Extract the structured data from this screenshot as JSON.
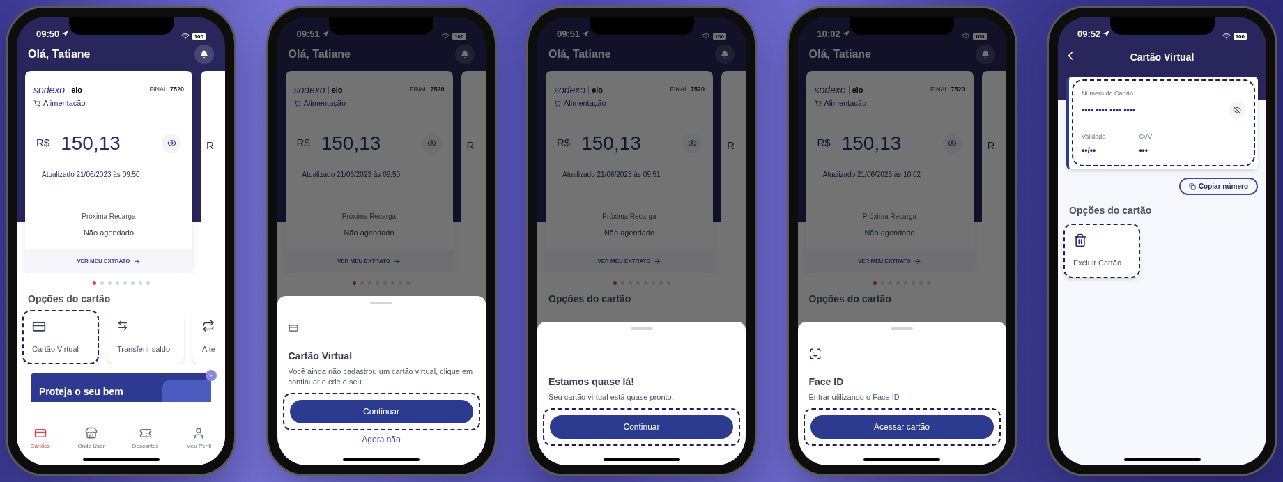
{
  "phones": [
    {
      "kind": "home",
      "time": "09:50",
      "battery": "100",
      "greeting": "Olá, Tatiane",
      "dimmed": false,
      "card": {
        "brand": "sodexo",
        "network": "elo",
        "final_label": "FINAL",
        "final_number": "7520",
        "category": "Alimentação",
        "currency": "R$",
        "amount": "150,13",
        "updated": "Atualizado 21/06/2023 às 09:50",
        "next_label": "Próxima Recarga",
        "next_value": "Não agendado",
        "statement_link": "VER MEU EXTRATO"
      },
      "peek_text": "R",
      "dots": [
        {
          "selected": true
        },
        {
          "selected": false
        },
        {
          "selected": false
        },
        {
          "selected": false
        },
        {
          "selected": false
        },
        {
          "selected": false
        },
        {
          "selected": false
        },
        {
          "selected": false
        }
      ],
      "options_title": "Opções do cartão",
      "options": [
        {
          "kind": "virtual-card",
          "label": "Cartão Virtual",
          "highlighted": true
        },
        {
          "kind": "transfer",
          "label": "Transferir saldo",
          "highlighted": false
        },
        {
          "kind": "swap",
          "label": "Alte",
          "highlighted": false
        }
      ],
      "banner": "Proteja o seu bem",
      "nav": [
        {
          "kind": "cards",
          "label": "Cartões",
          "selected": true
        },
        {
          "kind": "store",
          "label": "Onde Usar",
          "selected": false
        },
        {
          "kind": "ticket",
          "label": "Descontos",
          "selected": false
        },
        {
          "kind": "profile",
          "label": "Meu Perfil",
          "selected": false
        }
      ]
    },
    {
      "kind": "home",
      "time": "09:51",
      "battery": "100",
      "greeting": "Olá, Tatiane",
      "dimmed": true,
      "card": {
        "brand": "sodexo",
        "network": "elo",
        "final_label": "FINAL",
        "final_number": "7520",
        "category": "Alimentação",
        "currency": "R$",
        "amount": "150,13",
        "updated": "Atualizado 21/06/2023 às 09:50",
        "next_label": "Próxima Recarga",
        "next_value": "Não agendado",
        "statement_link": "VER MEU EXTRATO"
      },
      "peek_text": "R",
      "dots": [
        {
          "selected": true
        },
        {
          "selected": false
        },
        {
          "selected": false
        },
        {
          "selected": false
        },
        {
          "selected": false
        },
        {
          "selected": false
        },
        {
          "selected": false
        },
        {
          "selected": false
        }
      ],
      "sheet": {
        "kind": "card",
        "title": "Cartão Virtual",
        "text": "Você ainda não cadastrou um cartão virtual, clique em continuar e crie o seu.",
        "primary": "Continuar",
        "highlighted": true,
        "secondary": "Agora não"
      }
    },
    {
      "kind": "home",
      "time": "09:51",
      "battery": "100",
      "greeting": "Olá, Tatiane",
      "dimmed": true,
      "card": {
        "brand": "sodexo",
        "network": "elo",
        "final_label": "FINAL",
        "final_number": "7520",
        "category": "Alimentação",
        "currency": "R$",
        "amount": "150,13",
        "updated": "Atualizado 21/06/2023 às 09:51",
        "next_label": "Próxima Recarga",
        "next_value": "Não agendado",
        "statement_link": "VER MEU EXTRATO"
      },
      "peek_text": "R",
      "dots": [
        {
          "selected": true
        },
        {
          "selected": false
        },
        {
          "selected": false
        },
        {
          "selected": false
        },
        {
          "selected": false
        },
        {
          "selected": false
        },
        {
          "selected": false
        },
        {
          "selected": false
        }
      ],
      "options_title": "Opções do cartão",
      "sheet": {
        "title": "Estamos quase lá!",
        "text": "Seu cartão virtual está quase pronto.",
        "primary": "Continuar",
        "highlighted": true
      }
    },
    {
      "kind": "home",
      "time": "10:02",
      "battery": "100",
      "greeting": "Olá, Tatiane",
      "dimmed": true,
      "card": {
        "brand": "sodexo",
        "network": "elo",
        "final_label": "FINAL",
        "final_number": "7520",
        "category": "Alimentação",
        "currency": "R$",
        "amount": "150,13",
        "updated": "Atualizado 21/06/2023 às 10:02",
        "next_label": "Próxima Recarga",
        "next_value": "Não agendado",
        "statement_link": "VER MEU EXTRATO"
      },
      "peek_text": "R",
      "dots": [
        {
          "selected": true
        },
        {
          "selected": false
        },
        {
          "selected": false
        },
        {
          "selected": false
        },
        {
          "selected": false
        },
        {
          "selected": false
        },
        {
          "selected": false
        },
        {
          "selected": false
        }
      ],
      "options_title": "Opções do cartão",
      "sheet": {
        "kind": "face",
        "title": "Face ID",
        "text": "Entrar utilizando o Face ID",
        "primary": "Acessar cartão",
        "highlighted": true
      }
    },
    {
      "kind": "virtual",
      "time": "09:52",
      "battery": "100",
      "title": "Cartão Virtual",
      "details": {
        "highlighted": true,
        "number_label": "Número do Cartão",
        "number": "•••• •••• •••• ••••",
        "expiry_label": "Validade",
        "expiry": "••/••",
        "cvv_label": "CVV",
        "cvv": "•••"
      },
      "copy_button": "Copiar número",
      "options_title": "Opções do cartão",
      "options": [
        {
          "kind": "delete",
          "label": "Excluir Cartão",
          "highlighted": true
        }
      ]
    }
  ]
}
